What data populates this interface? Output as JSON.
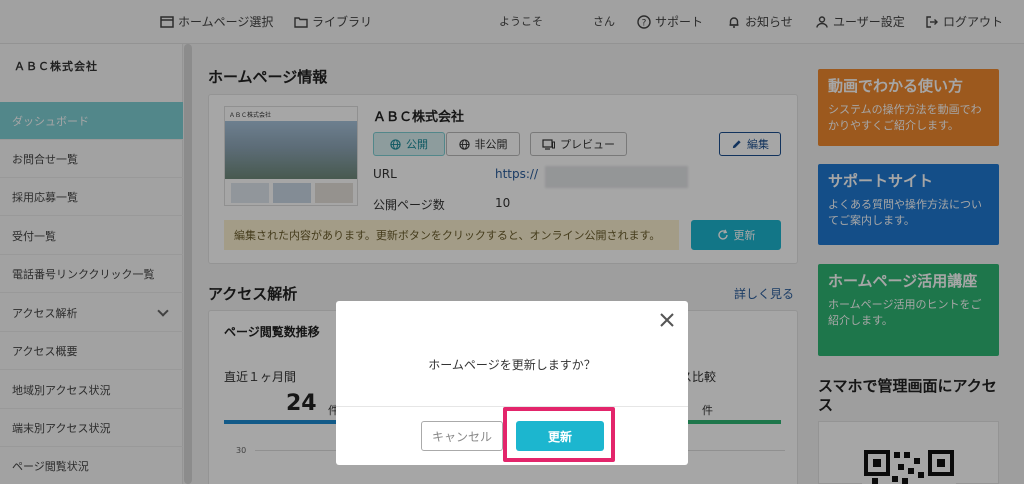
{
  "topbar": {
    "homepage_select": "ホームページ選択",
    "library": "ライブラリ",
    "welcome": "ようこそ",
    "san": "さん",
    "support": "サポート",
    "notice": "お知らせ",
    "user_settings": "ユーザー設定",
    "logout": "ログアウト"
  },
  "sidebar": {
    "company": "ＡＢＣ株式会社",
    "items": [
      {
        "label": "ダッシュボード"
      },
      {
        "label": "お問合せ一覧"
      },
      {
        "label": "採用応募一覧"
      },
      {
        "label": "受付一覧"
      },
      {
        "label": "電話番号リンククリック一覧"
      },
      {
        "label": "アクセス解析"
      },
      {
        "label": "アクセス概要"
      },
      {
        "label": "地域別アクセス状況"
      },
      {
        "label": "端末別アクセス状況"
      },
      {
        "label": "ページ閲覧状況"
      }
    ]
  },
  "homepage": {
    "section_title": "ホームページ情報",
    "company": "ＡＢＣ株式会社",
    "thumb_company": "ＡＢＣ株式会社",
    "publish": "公開",
    "unpublish": "非公開",
    "preview": "プレビュー",
    "edit": "編集",
    "url_label": "URL",
    "url_value": "https://",
    "pages_label": "公開ページ数",
    "pages_value": "10",
    "notice": "編集された内容があります。更新ボタンをクリックすると、オンライン公開されます。",
    "update": "更新"
  },
  "access": {
    "section_title": "アクセス解析",
    "details": "詳しく見る",
    "chart_title": "ページ閲覧数推移",
    "recent_month": "直近１ヶ月間",
    "count": "24",
    "unit": "件",
    "compare_partial": "ス比較",
    "unit2": "件",
    "axis_tick": "30"
  },
  "promo": {
    "video_title": "動画でわかる使い方",
    "video_desc": "システムの操作方法を動画でわかりやすくご紹介します。",
    "support_title": "サポートサイト",
    "support_desc": "よくある質問や操作方法についてご案内します。",
    "course_title": "ホームページ活用講座",
    "course_desc": "ホームページ活用のヒントをご紹介します。",
    "mobile_title": "スマホで管理画面にアクセス"
  },
  "modal": {
    "message": "ホームページを更新しますか？",
    "cancel": "キャンセル",
    "confirm": "更新"
  },
  "colors": {
    "accent": "#1cb6cf",
    "sidebar_active": "#7ecfd4",
    "highlight": "#e3256b",
    "promo_orange": "#f0892f",
    "promo_blue": "#1f78d1",
    "promo_green": "#2fb673"
  }
}
